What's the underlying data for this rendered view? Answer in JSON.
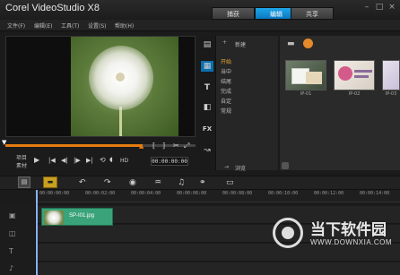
{
  "app": {
    "title": "Corel VideoStudio X8"
  },
  "tabs": [
    {
      "label": "捕获"
    },
    {
      "label": "编辑",
      "active": true
    },
    {
      "label": "共享"
    }
  ],
  "window_controls": {
    "minimize": "–",
    "maximize": "□",
    "close": "×"
  },
  "menu": [
    "文件(F)",
    "编辑(E)",
    "工具(T)",
    "设置(S)",
    "帮助(H)"
  ],
  "preview": {
    "mode_project": "项目",
    "mode_clip": "素材",
    "buttons": {
      "play": "▶",
      "home": "|◀",
      "prev": "◀|",
      "next": "|▶",
      "end": "▶|",
      "repeat": "⟲",
      "volume": "🔈",
      "hd": "HD"
    },
    "trim_markers": [
      "[",
      "]"
    ],
    "timecode": "00:00:00:00",
    "scrub_progress": 0.72
  },
  "library": {
    "add_label": "新建",
    "categories": [
      {
        "label": "开始",
        "selected": true
      },
      {
        "label": "当中"
      },
      {
        "label": "结尾"
      },
      {
        "label": "完成"
      },
      {
        "label": "自定"
      },
      {
        "label": "常规"
      }
    ],
    "bottom_label": "浏览",
    "thumbnails": [
      {
        "label": "IP-01"
      },
      {
        "label": "IP-02"
      },
      {
        "label": "IP-03"
      }
    ],
    "vtools": [
      "media-icon",
      "instant-project-icon",
      "title-icon",
      "transition-icon",
      "fx-icon",
      "path-icon"
    ]
  },
  "timeline": {
    "ruler": [
      "00:00:00:00",
      "00:00:02:00",
      "00:00:04:00",
      "00:00:06:00",
      "00:00:08:00",
      "00:00:10:00",
      "00:00:12:00",
      "00:00:14:00"
    ],
    "clip_label": "SP-I01.jpg"
  },
  "watermark": {
    "name": "当下软件园",
    "url": "WWW.DOWNXIA.COM"
  },
  "colors": {
    "accent": "#0a78c2",
    "scrub": "#e57c10",
    "clip": "#3aa37a",
    "category_selected": "#e9a93a"
  }
}
